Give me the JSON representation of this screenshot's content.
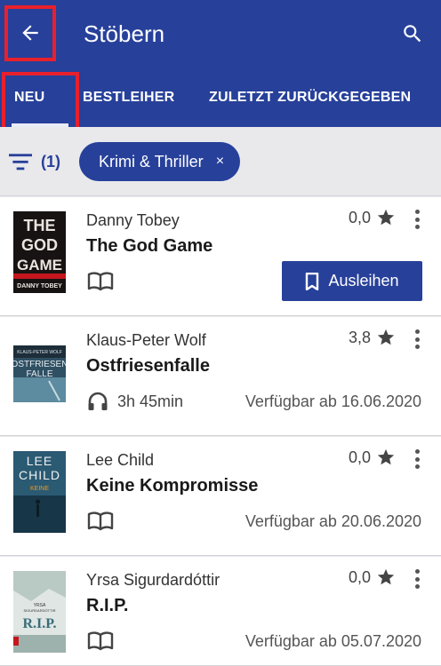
{
  "header": {
    "title": "Stöbern",
    "back_icon": "arrow-left-icon",
    "search_icon": "search-icon",
    "bg_color": "#27409a",
    "highlight_color": "#e8202c"
  },
  "tabs": [
    {
      "label": "NEU",
      "active": true
    },
    {
      "label": "BESTLEIHER",
      "active": false
    },
    {
      "label": "ZULETZT ZURÜCKGEGEBEN",
      "active": false
    }
  ],
  "filter": {
    "count_label": "(1)",
    "chip_label": "Krimi & Thriller",
    "chip_close": "×"
  },
  "books": [
    {
      "author": "Danny Tobey",
      "title": "The God Game",
      "rating": "0,0",
      "format": "ebook",
      "format_icon": "book-open-icon",
      "action_label": "Ausleihen",
      "availability": ""
    },
    {
      "author": "Klaus-Peter Wolf",
      "title": "Ostfriesenfalle",
      "rating": "3,8",
      "format": "audiobook",
      "format_icon": "headphones-icon",
      "duration": "3h 45min",
      "availability": "Verfügbar ab 16.06.2020"
    },
    {
      "author": "Lee Child",
      "title": "Keine Kompromisse",
      "rating": "0,0",
      "format": "ebook",
      "format_icon": "book-open-icon",
      "availability": "Verfügbar ab 20.06.2020"
    },
    {
      "author": "Yrsa Sigurdardóttir",
      "title": "R.I.P.",
      "rating": "0,0",
      "format": "ebook",
      "format_icon": "book-open-icon",
      "availability": "Verfügbar ab 05.07.2020"
    }
  ],
  "covers": {
    "cover1": [
      "THE",
      "GOD",
      "GAME",
      "DANNY TOBEY"
    ],
    "cover2": [
      "KLAUS-PETER WOLF",
      "OSTFRIESEN",
      "FALLE"
    ],
    "cover3": [
      "LEE",
      "CHILD",
      "KEINE"
    ],
    "cover4": [
      "YRSA",
      "SIGURDARDÓTTIR",
      "R.I.P."
    ]
  }
}
